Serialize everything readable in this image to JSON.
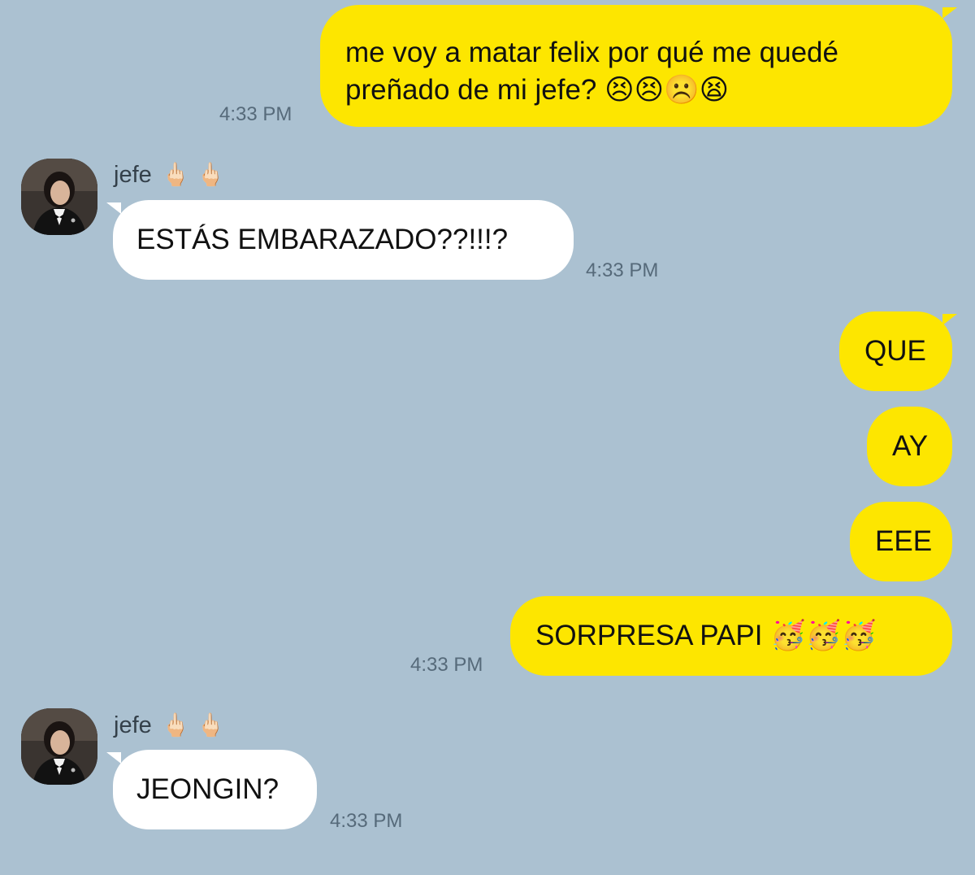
{
  "messages": [
    {
      "side": "out",
      "text": "me voy a matar felix por qué me quedé preñado de mi jefe? 😣😣☹️😫",
      "line1": "me voy a matar felix por qué me quedé",
      "line2": "preñado de mi jefe? 😣😣☹️😫",
      "time": "4:33 PM"
    },
    {
      "side": "in",
      "sender": "jefe",
      "sender_emoji": "🖕🏻🖕🏻",
      "text": "ESTÁS EMBARAZADO??!!!?",
      "time": "4:33 PM"
    },
    {
      "side": "out",
      "text": "QUE"
    },
    {
      "side": "out",
      "text": "AY"
    },
    {
      "side": "out",
      "text": "EEE"
    },
    {
      "side": "out",
      "text": "SORPRESA PAPI 🥳🥳🥳",
      "time": "4:33 PM"
    },
    {
      "side": "in",
      "sender": "jefe",
      "sender_emoji": "🖕🏻🖕🏻",
      "text": "JEONGIN?",
      "time": "4:33 PM"
    }
  ],
  "colors": {
    "background": "#abc1d1",
    "outgoing_bubble": "#fde600",
    "incoming_bubble": "#ffffff",
    "timestamp": "#566a7a"
  }
}
